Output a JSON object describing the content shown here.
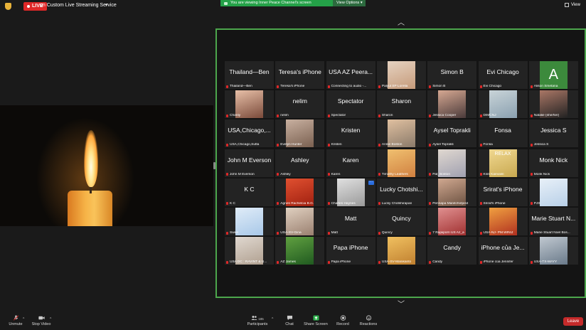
{
  "topbar": {
    "live_badge": "LIVE",
    "live_text": "on Custom Live Streaming Service",
    "viewing_banner": "You are viewing Inner Peace Channel's screen",
    "view_options": "View Options",
    "view_label": "View"
  },
  "tiles": [
    {
      "name": "Thailand—Ben",
      "label": "Thailand—Ben"
    },
    {
      "name": "Teresa's iPhone",
      "label": "Teresa's iPhone"
    },
    {
      "name": "USA AZ Peera...",
      "label": "Connecting to audio -..."
    },
    {
      "name": "",
      "label": "Palyul SP Lorella"
    },
    {
      "name": "Simon B",
      "label": "Simon B"
    },
    {
      "name": "Evi Chicago",
      "label": "Evi Chicago"
    },
    {
      "name": "",
      "label": "Alison Smetana"
    },
    {
      "name": "",
      "label": "Chanty"
    },
    {
      "name": "nelim",
      "label": "nelim"
    },
    {
      "name": "Spectator",
      "label": "Spectator"
    },
    {
      "name": "Sharon",
      "label": "Sharon"
    },
    {
      "name": "",
      "label": "Jessica Cooper"
    },
    {
      "name": "",
      "label": "DIMCNJ"
    },
    {
      "name": "",
      "label": "Natalie (she/her)"
    },
    {
      "name": "USA,Chicago,...",
      "label": "USA,Chicago,Sutta"
    },
    {
      "name": "",
      "label": "Evelyn Hunter"
    },
    {
      "name": "Kristen",
      "label": "Kristen"
    },
    {
      "name": "",
      "label": "Annie Boston"
    },
    {
      "name": "Aysel Toprakli",
      "label": "Aysel Toprakli"
    },
    {
      "name": "Fonsa",
      "label": "Fonsa"
    },
    {
      "name": "Jessica S",
      "label": "Jessica S"
    },
    {
      "name": "John M Everson",
      "label": "John M Everson"
    },
    {
      "name": "Ashley",
      "label": "Ashley"
    },
    {
      "name": "Karen",
      "label": "Karen"
    },
    {
      "name": "",
      "label": "Timothy Leathers"
    },
    {
      "name": "",
      "label": "Pat_Boston"
    },
    {
      "name": "",
      "label": "Klint Kaevalin"
    },
    {
      "name": "Monk Nick",
      "label": "Monk Nick"
    },
    {
      "name": "K C",
      "label": "K C"
    },
    {
      "name": "",
      "label": "Agnes Rachelcia B.G."
    },
    {
      "name": "",
      "label": "Charles Haynes"
    },
    {
      "name": "Lucky Chotshi...",
      "label": "Lucky Chotshirapan"
    },
    {
      "name": "",
      "label": "Pennapa Manitchotpisit"
    },
    {
      "name": "Srirat's iPhone",
      "label": "Srirat's iPhone"
    },
    {
      "name": "",
      "label": "PJS"
    },
    {
      "name": "",
      "label": "Swee"
    },
    {
      "name": "",
      "label": "USA-SV-Gina"
    },
    {
      "name": "Matt",
      "label": "Matt"
    },
    {
      "name": "Quincy",
      "label": "Quincy"
    },
    {
      "name": "",
      "label": "7 Rapiiporn US Az_a"
    },
    {
      "name": "",
      "label": "USA-NJ- PM.WINIJ"
    },
    {
      "name": "Marie Stuart N...",
      "label": "Marie Stuart Noel Bos..."
    },
    {
      "name": "",
      "label": "USA DC : RAVINT & U..."
    },
    {
      "name": "",
      "label": "AZ James"
    },
    {
      "name": "Papa iPhone",
      "label": "Papa iPhone"
    },
    {
      "name": "",
      "label": "USA-SV-Manikanto"
    },
    {
      "name": "Candy",
      "label": "Candy"
    },
    {
      "name": "iPhone của Je...",
      "label": "iPhone của Jennifer"
    },
    {
      "name": "",
      "label": "USA-TX-MAYY"
    }
  ],
  "avatar_letter": "A",
  "toolbar": {
    "unmute": "Unmute",
    "stop_video": "Stop Video",
    "participants": "Participants",
    "participants_count": "185",
    "chat": "Chat",
    "share_screen": "Share Screen",
    "record": "Record",
    "reactions": "Reactions",
    "leave": "Leave"
  }
}
